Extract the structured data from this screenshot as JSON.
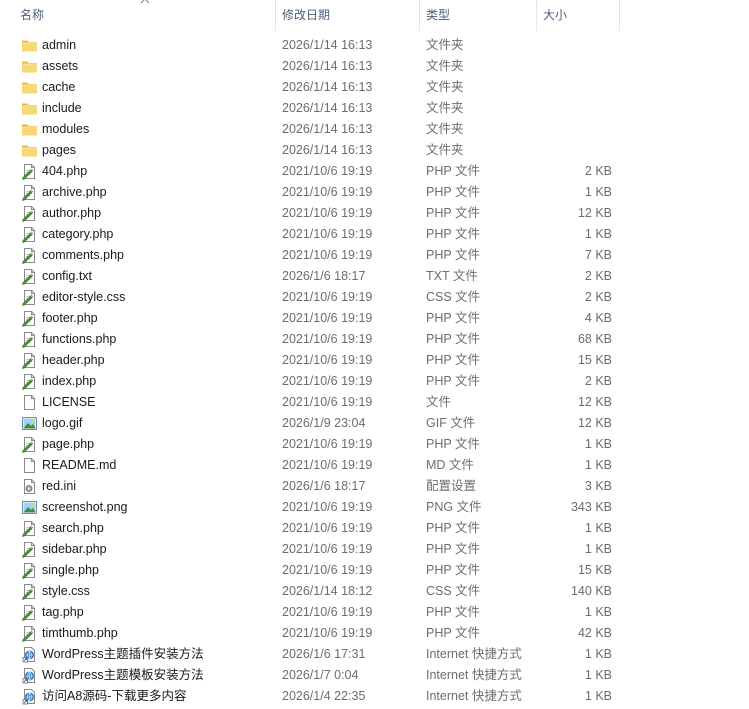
{
  "columns": {
    "name": "名称",
    "date": "修改日期",
    "type": "类型",
    "size": "大小"
  },
  "sort": {
    "column": "name",
    "direction": "ascending",
    "icon": "chevron-up-icon"
  },
  "files": [
    {
      "name": "admin",
      "date": "2026/1/14 16:13",
      "type": "文件夹",
      "size": "",
      "icon": "folder-icon"
    },
    {
      "name": "assets",
      "date": "2026/1/14 16:13",
      "type": "文件夹",
      "size": "",
      "icon": "folder-icon"
    },
    {
      "name": "cache",
      "date": "2026/1/14 16:13",
      "type": "文件夹",
      "size": "",
      "icon": "folder-icon"
    },
    {
      "name": "include",
      "date": "2026/1/14 16:13",
      "type": "文件夹",
      "size": "",
      "icon": "folder-icon"
    },
    {
      "name": "modules",
      "date": "2026/1/14 16:13",
      "type": "文件夹",
      "size": "",
      "icon": "folder-icon"
    },
    {
      "name": "pages",
      "date": "2026/1/14 16:13",
      "type": "文件夹",
      "size": "",
      "icon": "folder-icon"
    },
    {
      "name": "404.php",
      "date": "2021/10/6 19:19",
      "type": "PHP 文件",
      "size": "2 KB",
      "icon": "editable-file-icon"
    },
    {
      "name": "archive.php",
      "date": "2021/10/6 19:19",
      "type": "PHP 文件",
      "size": "1 KB",
      "icon": "editable-file-icon"
    },
    {
      "name": "author.php",
      "date": "2021/10/6 19:19",
      "type": "PHP 文件",
      "size": "12 KB",
      "icon": "editable-file-icon"
    },
    {
      "name": "category.php",
      "date": "2021/10/6 19:19",
      "type": "PHP 文件",
      "size": "1 KB",
      "icon": "editable-file-icon"
    },
    {
      "name": "comments.php",
      "date": "2021/10/6 19:19",
      "type": "PHP 文件",
      "size": "7 KB",
      "icon": "editable-file-icon"
    },
    {
      "name": "config.txt",
      "date": "2026/1/6 18:17",
      "type": "TXT 文件",
      "size": "2 KB",
      "icon": "editable-file-icon"
    },
    {
      "name": "editor-style.css",
      "date": "2021/10/6 19:19",
      "type": "CSS 文件",
      "size": "2 KB",
      "icon": "editable-file-icon"
    },
    {
      "name": "footer.php",
      "date": "2021/10/6 19:19",
      "type": "PHP 文件",
      "size": "4 KB",
      "icon": "editable-file-icon"
    },
    {
      "name": "functions.php",
      "date": "2021/10/6 19:19",
      "type": "PHP 文件",
      "size": "68 KB",
      "icon": "editable-file-icon"
    },
    {
      "name": "header.php",
      "date": "2021/10/6 19:19",
      "type": "PHP 文件",
      "size": "15 KB",
      "icon": "editable-file-icon"
    },
    {
      "name": "index.php",
      "date": "2021/10/6 19:19",
      "type": "PHP 文件",
      "size": "2 KB",
      "icon": "editable-file-icon"
    },
    {
      "name": "LICENSE",
      "date": "2021/10/6 19:19",
      "type": "文件",
      "size": "12 KB",
      "icon": "blank-file-icon"
    },
    {
      "name": "logo.gif",
      "date": "2026/1/9 23:04",
      "type": "GIF 文件",
      "size": "12 KB",
      "icon": "image-file-icon"
    },
    {
      "name": "page.php",
      "date": "2021/10/6 19:19",
      "type": "PHP 文件",
      "size": "1 KB",
      "icon": "editable-file-icon"
    },
    {
      "name": "README.md",
      "date": "2021/10/6 19:19",
      "type": "MD 文件",
      "size": "1 KB",
      "icon": "blank-file-icon"
    },
    {
      "name": "red.ini",
      "date": "2026/1/6 18:17",
      "type": "配置设置",
      "size": "3 KB",
      "icon": "settings-file-icon"
    },
    {
      "name": "screenshot.png",
      "date": "2021/10/6 19:19",
      "type": "PNG 文件",
      "size": "343 KB",
      "icon": "image-file-icon"
    },
    {
      "name": "search.php",
      "date": "2021/10/6 19:19",
      "type": "PHP 文件",
      "size": "1 KB",
      "icon": "editable-file-icon"
    },
    {
      "name": "sidebar.php",
      "date": "2021/10/6 19:19",
      "type": "PHP 文件",
      "size": "1 KB",
      "icon": "editable-file-icon"
    },
    {
      "name": "single.php",
      "date": "2021/10/6 19:19",
      "type": "PHP 文件",
      "size": "15 KB",
      "icon": "editable-file-icon"
    },
    {
      "name": "style.css",
      "date": "2026/1/14 18:12",
      "type": "CSS 文件",
      "size": "140 KB",
      "icon": "editable-file-icon"
    },
    {
      "name": "tag.php",
      "date": "2021/10/6 19:19",
      "type": "PHP 文件",
      "size": "1 KB",
      "icon": "editable-file-icon"
    },
    {
      "name": "timthumb.php",
      "date": "2021/10/6 19:19",
      "type": "PHP 文件",
      "size": "42 KB",
      "icon": "editable-file-icon"
    },
    {
      "name": "WordPress主题插件安装方法",
      "date": "2026/1/6 17:31",
      "type": "Internet 快捷方式",
      "size": "1 KB",
      "icon": "internet-shortcut-icon"
    },
    {
      "name": "WordPress主题模板安装方法",
      "date": "2026/1/7 0:04",
      "type": "Internet 快捷方式",
      "size": "1 KB",
      "icon": "internet-shortcut-icon"
    },
    {
      "name": "访问A8源码-下载更多内容",
      "date": "2026/1/4 22:35",
      "type": "Internet 快捷方式",
      "size": "1 KB",
      "icon": "internet-shortcut-icon"
    }
  ],
  "colors": {
    "header_text": "#4c607a",
    "name_text": "#1a1a1a",
    "meta_text": "#6d6d6d",
    "folder": "#f8d775",
    "folder_dark": "#e8b84a"
  }
}
